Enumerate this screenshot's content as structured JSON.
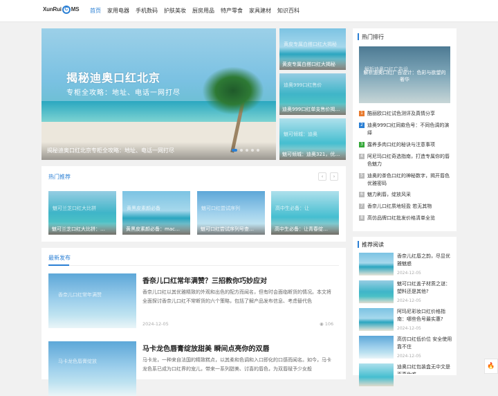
{
  "header": {
    "logo_left": "XunRui",
    "logo_mid": "C",
    "logo_right": "MS",
    "nav": [
      "首页",
      "家用电器",
      "手机数码",
      "护肤美妆",
      "厨房用品",
      "特产零食",
      "家具建材",
      "知识百科"
    ]
  },
  "slider": {
    "overlay_title": "揭秘迪奥口红北京",
    "overlay_sub": "专柜全攻略：地址、电话一网打尽",
    "caption": "揭秘迪奥口红北京专柜全攻略：地址、电话一网打尽"
  },
  "tiles": [
    {
      "caption": "黄皮专属白搭口红大揭秘",
      "overlay": "黄皮专属白搭口红大揭秘"
    },
    {
      "caption": "迪奥999口红单支售价揭…",
      "overlay": "迪奥999口红售价"
    },
    {
      "caption": "魅可倾城：迪奥321，优…",
      "overlay": "魅可倾城：迪奥"
    }
  ],
  "hot": {
    "title": "热门推荐",
    "prev": "‹",
    "next": "›",
    "items": [
      {
        "caption": "魅可兰芝口红大比拼：…",
        "overlay": "魅可兰芝口红大比拼"
      },
      {
        "caption": "黄黑皮素颜必备：mac…",
        "overlay": "黄黑皮素颜必备"
      },
      {
        "caption": "魅可口红尝试序列号查…",
        "overlay": "魅可口红尝试序列"
      },
      {
        "caption": "高中生必备：让青春绽…",
        "overlay": "高中生必备：让"
      }
    ]
  },
  "latest": {
    "title": "最新发布",
    "articles": [
      {
        "title": "香奈儿口红常年满赞？三招教你巧妙应对",
        "desc": "香奈儿口红以其优雅精致的外观和出色的配方而闻名，但有时会面临断货的情况。本文将全面探讨香奈儿口红不常断货的六个策略，包括了解产品发布信息、考虑替代色",
        "date": "2024-12-05",
        "views": "106",
        "overlay": "香奈儿口红常年满赞"
      },
      {
        "title": "马卡龙色唇膏绽放甜美 瞬间点亮你的双唇",
        "desc": "马卡龙，一种来自法国的精致糕点，以其柔和色调和入口即化的口感而闻名。如今，马卡龙色系已成为口红界的宠儿，带来一系列甜美、讨喜的唇色，为双唇赋予少女般",
        "date": "",
        "views": "",
        "overlay": "马卡龙色唇膏绽放"
      }
    ]
  },
  "ranking": {
    "title": "热门排行",
    "banner_text": "解析迪奥口红广告设计：色彩与欲望的奢华",
    "banner_overlay": "解析迪奥口红广告设",
    "items": [
      {
        "num": "1",
        "text": "酷丽欧口红试色测评及真情分享"
      },
      {
        "num": "2",
        "text": "迪奥999口红同款色号：不同色调的演绎"
      },
      {
        "num": "3",
        "text": "露养多肉口红的秘诀与注意事项"
      },
      {
        "num": "4",
        "text": "阿尼玛口红奇选指南，打造专属你的唇色魅力"
      },
      {
        "num": "5",
        "text": "迪奥的茶色口红的神秘数字，揭开唇色优雅密码"
      },
      {
        "num": "6",
        "text": "魅力刷唇，绽放风采"
      },
      {
        "num": "7",
        "text": "香奈儿口红质地轻盈 若无其物"
      },
      {
        "num": "8",
        "text": "高仿品牌口红批发价格清单全览"
      }
    ],
    "colors": [
      "#e87a2e",
      "#2a7fd4",
      "#35a839",
      "#bbbbbb"
    ]
  },
  "recommend": {
    "title": "推荐阅读",
    "items": [
      {
        "title": "香奈儿红唇之韵，尽显优雅魅惑",
        "date": "2024-12-05"
      },
      {
        "title": "魅可口红盖子材质之谜：塑料还是其他?",
        "date": "2024-12-05"
      },
      {
        "title": "阿玛尼彩妆口红价格指南：哪些色号最实惠?",
        "date": "2024-12-05"
      },
      {
        "title": "高仿口红低价位 安全使用靠不住",
        "date": "2024-12-05"
      },
      {
        "title": "迪奥口红包装盒无中文是否真伪难",
        "date": ""
      }
    ]
  },
  "fire_icon": "🔥"
}
